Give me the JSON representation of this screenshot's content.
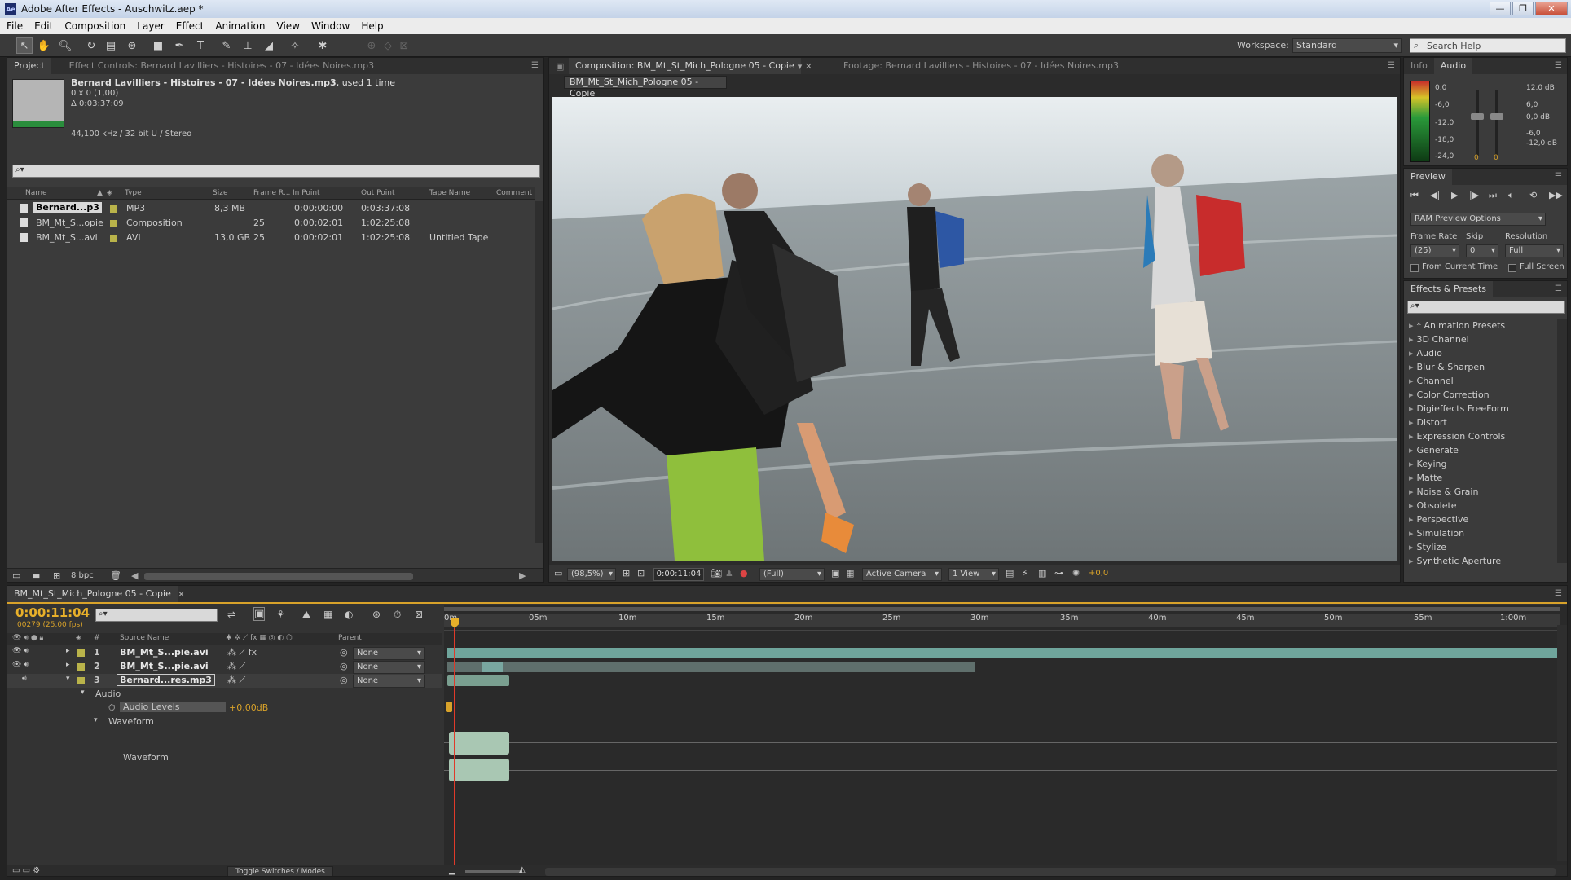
{
  "app": {
    "title": "Adobe After Effects - Auschwitz.aep *",
    "icon_label": "Ae"
  },
  "window_controls": {
    "minimize": "—",
    "maximize": "❐",
    "close": "✕"
  },
  "menu": [
    "File",
    "Edit",
    "Composition",
    "Layer",
    "Effect",
    "Animation",
    "View",
    "Window",
    "Help"
  ],
  "toolbar": {
    "workspace_label": "Workspace:",
    "workspace_value": "Standard",
    "search_placeholder": "Search Help"
  },
  "project": {
    "tab_project": "Project",
    "tab_effect_controls": "Effect Controls: Bernard Lavilliers - Histoires - 07 - Idées Noires.mp3",
    "item_name": "Bernard Lavilliers - Histoires - 07 - Idées Noires.mp3",
    "item_used": ", used 1 time",
    "item_dims": "0 x 0 (1,00)",
    "item_duration": "Δ 0:03:37:09",
    "item_audio": "44,100 kHz / 32 bit U / Stereo",
    "columns": [
      "Name",
      "Type",
      "Size",
      "Frame R...",
      "In Point",
      "Out Point",
      "Tape Name",
      "Comment"
    ],
    "rows": [
      {
        "name": "Bernard...p3",
        "type": "MP3",
        "size": "8,3 MB",
        "fps": "",
        "in": "0:00:00:00",
        "out": "0:03:37:08",
        "tape": "",
        "color": "#b9b34a"
      },
      {
        "name": "BM_Mt_S...opie",
        "type": "Composition",
        "size": "",
        "fps": "25",
        "in": "0:00:02:01",
        "out": "1:02:25:08",
        "tape": "",
        "color": "#b9b34a"
      },
      {
        "name": "BM_Mt_S...avi",
        "type": "AVI",
        "size": "13,0 GB",
        "fps": "25",
        "in": "0:00:02:01",
        "out": "1:02:25:08",
        "tape": "Untitled Tape",
        "color": "#b9b34a"
      }
    ],
    "bpc": "8 bpc"
  },
  "comp_panel": {
    "tab_comp": "Composition: BM_Mt_St_Mich_Pologne 05 - Copie",
    "tab_footage": "Footage: Bernard Lavilliers - Histoires - 07 - Idées Noires.mp3",
    "breadcrumb": "BM_Mt_St_Mich_Pologne 05 - Copie",
    "zoom": "(98,5%)",
    "timecode": "0:00:11:04",
    "resolution": "(Full)",
    "camera": "Active Camera",
    "views": "1 View",
    "exposure": "+0,0"
  },
  "info_audio": {
    "tab_info": "Info",
    "tab_audio": "Audio",
    "meter_left": [
      "0,0",
      "-6,0",
      "-12,0",
      "-18,0",
      "-24,0"
    ],
    "meter_right": [
      "12,0 dB",
      "6,0",
      "0,0 dB",
      "-6,0",
      "-12,0 dB"
    ],
    "slider_values": [
      "0",
      "0"
    ]
  },
  "preview": {
    "tab": "Preview",
    "ram_options": "RAM Preview Options",
    "frame_rate_label": "Frame Rate",
    "skip_label": "Skip",
    "resolution_label": "Resolution",
    "frame_rate_value": "(25)",
    "skip_value": "0",
    "resolution_value": "Full",
    "from_current": "From Current Time",
    "full_screen": "Full Screen"
  },
  "effects": {
    "tab": "Effects & Presets",
    "items": [
      "* Animation Presets",
      "3D Channel",
      "Audio",
      "Blur & Sharpen",
      "Channel",
      "Color Correction",
      "Digieffects FreeForm",
      "Distort",
      "Expression Controls",
      "Generate",
      "Keying",
      "Matte",
      "Noise & Grain",
      "Obsolete",
      "Perspective",
      "Simulation",
      "Stylize",
      "Synthetic Aperture"
    ]
  },
  "timeline": {
    "tab": "BM_Mt_St_Mich_Pologne 05 - Copie",
    "timecode": "0:00:11:04",
    "frame_info": "00279 (25.00 fps)",
    "col_source": "Source Name",
    "col_parent": "Parent",
    "ruler": [
      "0m",
      "05m",
      "10m",
      "15m",
      "20m",
      "25m",
      "30m",
      "35m",
      "40m",
      "45m",
      "50m",
      "55m",
      "1:00m"
    ],
    "layers": [
      {
        "num": "1",
        "name": "BM_Mt_S...pie.avi",
        "parent": "None"
      },
      {
        "num": "2",
        "name": "BM_Mt_S...pie.avi",
        "parent": "None"
      },
      {
        "num": "3",
        "name": "Bernard...res.mp3",
        "parent": "None"
      }
    ],
    "audio_group": "Audio",
    "audio_levels_label": "Audio Levels",
    "audio_levels_value": "+0,00dB",
    "waveform_group": "Waveform",
    "waveform_label": "Waveform",
    "toggle_label": "Toggle Switches / Modes"
  }
}
